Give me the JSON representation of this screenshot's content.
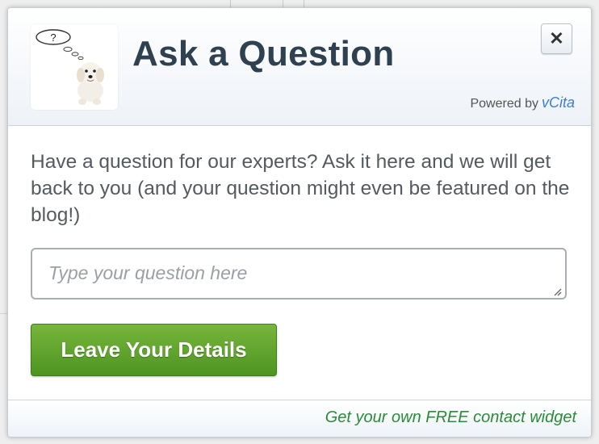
{
  "dialog": {
    "title": "Ask a Question",
    "close_label": "✕",
    "powered_by": "Powered by",
    "brand": "vCita",
    "avatar_bubble_text": "?"
  },
  "body": {
    "prompt": "Have a question for our experts? Ask it here and we will get back to you (and your question might even be featured on the blog!)",
    "question_placeholder": "Type your question here",
    "question_value": "",
    "details_button": "Leave Your Details"
  },
  "footer": {
    "link": "Get your own FREE contact widget"
  },
  "colors": {
    "title": "#2f4050",
    "button_green": "#5a9f2a",
    "brand_blue": "#3b7fd3",
    "footer_link": "#2c8a3a"
  }
}
